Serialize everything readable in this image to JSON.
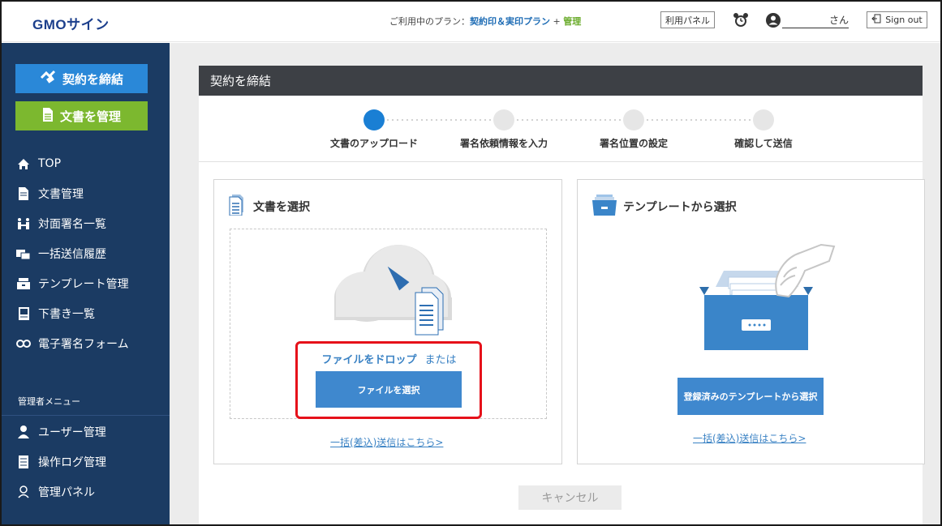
{
  "header": {
    "logo": "GMOサイン",
    "plan_prefix": "ご利用中のプラン：",
    "plan_name": "契約印＆実印プラン",
    "plan_sep": " + ",
    "plan_admin": "管理",
    "panel_button": "利用パネル",
    "user_suffix": "さん",
    "signout": "Sign out"
  },
  "sidebar": {
    "primary_button": "契約を締結",
    "secondary_button": "文書を管理",
    "nav": [
      {
        "label": "TOP",
        "icon": "home-icon"
      },
      {
        "label": "文書管理",
        "icon": "document-icon"
      },
      {
        "label": "対面署名一覧",
        "icon": "face-to-face-icon"
      },
      {
        "label": "一括送信履歴",
        "icon": "bulk-send-icon"
      },
      {
        "label": "テンプレート管理",
        "icon": "template-icon"
      },
      {
        "label": "下書き一覧",
        "icon": "draft-icon"
      },
      {
        "label": "電子署名フォーム",
        "icon": "link-icon"
      }
    ],
    "admin_label": "管理者メニュー",
    "admin_nav": [
      {
        "label": "ユーザー管理",
        "icon": "user-icon"
      },
      {
        "label": "操作ログ管理",
        "icon": "log-icon"
      },
      {
        "label": "管理パネル",
        "icon": "admin-panel-icon"
      }
    ]
  },
  "main": {
    "title": "契約を締結",
    "steps": [
      {
        "label": "文書のアップロード",
        "active": true
      },
      {
        "label": "署名依頼情報を入力",
        "active": false
      },
      {
        "label": "署名位置の設定",
        "active": false
      },
      {
        "label": "確認して送信",
        "active": false
      }
    ],
    "left_panel": {
      "title": "文書を選択",
      "drop_text": "ファイルをドロップ",
      "or_text": "または",
      "button": "ファイルを選択",
      "link": "一括(差込)送信はこちら>"
    },
    "right_panel": {
      "title": "テンプレートから選択",
      "button": "登録済みのテンプレートから選択",
      "link": "一括(差込)送信はこちら>"
    },
    "cancel": "キャンセル"
  },
  "colors": {
    "sidebar_bg": "#1b3b63",
    "primary": "#2a88d8",
    "secondary": "#7cb82f",
    "accent_link": "#3a82c4",
    "highlight": "#e6111a"
  }
}
